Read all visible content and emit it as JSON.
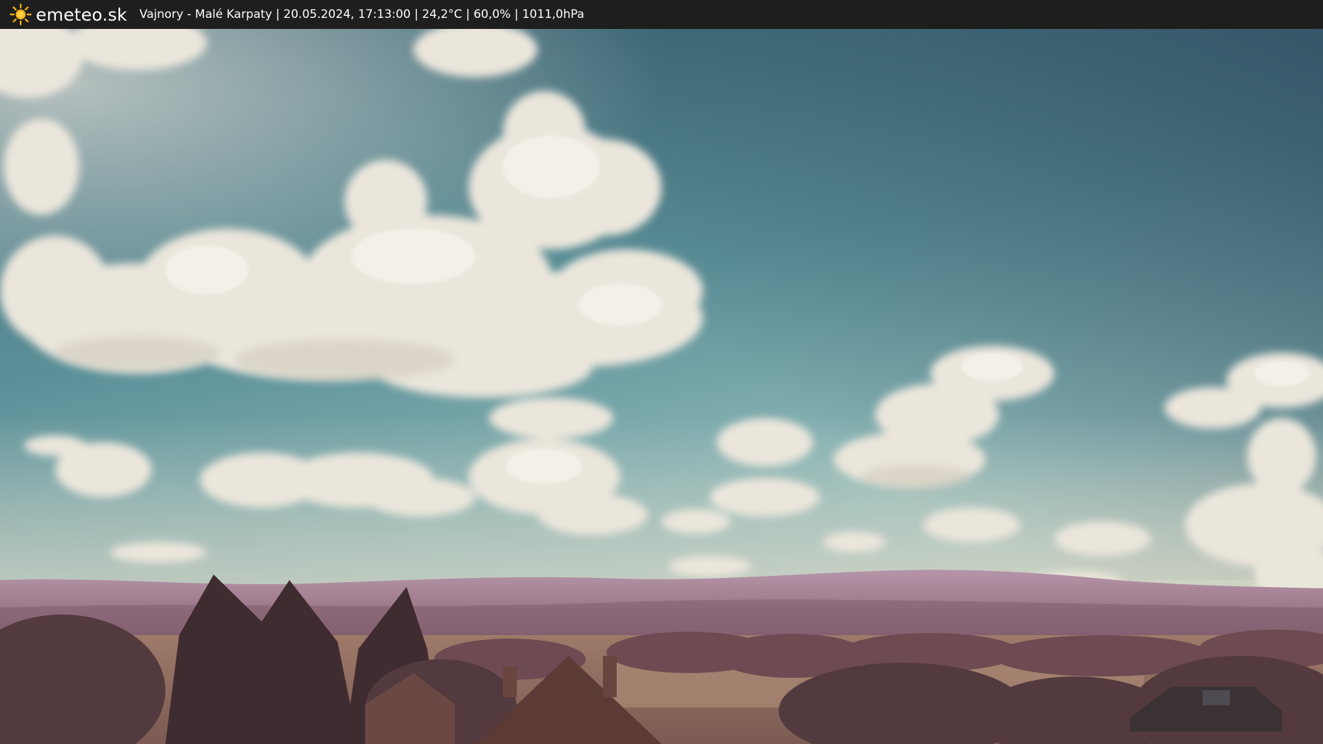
{
  "header": {
    "brand": "emeteo.sk",
    "caption": "Vajnory - Malé Karpaty | 20.05.2024, 17:13:00 | 24,2°C | 60,0% | 1011,0hPa"
  },
  "icons": {
    "logo": "sun-icon"
  },
  "colors": {
    "bar_background": "#1e1e1e",
    "bar_text": "#ffffff",
    "sun_yellow": "#f6b21a",
    "sky_upper": "#3f6f7c",
    "sky_lower": "#9cc4c2",
    "hills": "#a8879a",
    "foreground": "#5a3c40"
  }
}
